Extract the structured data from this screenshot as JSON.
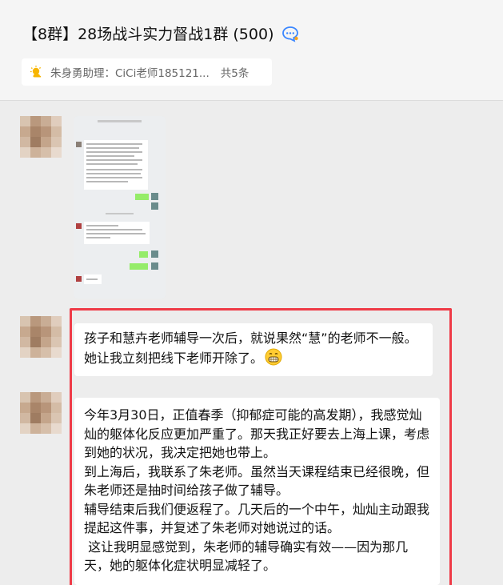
{
  "header": {
    "title": "【8群】28场战斗实力督战1群 (500)",
    "notice_text": "朱身勇助理：CiCi老师185121...",
    "notice_count": "共5条"
  },
  "messages": [
    {
      "type": "image"
    },
    {
      "type": "text",
      "text": "孩子和慧卉老师辅导一次后，就说果然“慧”的老师不一般。她让我立刻把线下老师开除了。"
    },
    {
      "type": "text",
      "paragraphs": [
        "今年3月30日，正值春季（抑郁症可能的高发期），我感觉灿灿的躯体化反应更加严重了。那天我正好要去上海上课，考虑到她的状况，我决定把她也带上。",
        "到上海后，我联系了朱老师。虽然当天课程结束已经很晚，但朱老师还是抽时间给孩子做了辅导。",
        "辅导结束后我们便返程了。几天后的一个中午，灿灿主动跟我提起这件事，并复述了朱老师对她说过的话。",
        " 这让我明显感觉到，朱老师的辅导确实有效——因为那几天，她的躯体化症状明显减轻了。"
      ]
    }
  ],
  "colors": {
    "highlight_border": "#ef3b47",
    "bubble_bg": "#ffffff",
    "chat_bg": "#ededed"
  }
}
